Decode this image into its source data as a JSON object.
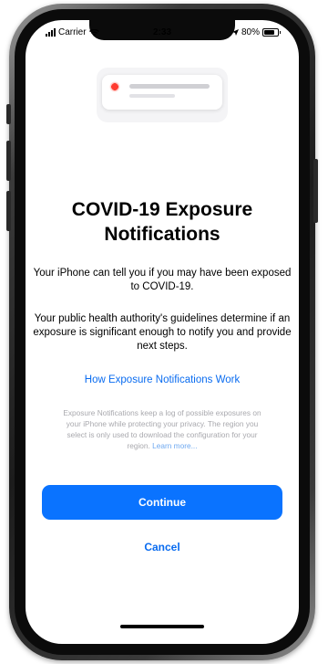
{
  "status_bar": {
    "carrier": "Carrier",
    "time": "2:33",
    "battery_text": "80%",
    "battery_level": 0.8
  },
  "icons": {
    "signal": "signal-bars-icon",
    "wifi": "wifi-icon",
    "location": "location-arrow-icon",
    "battery": "battery-icon",
    "illustration": "exposure-notification-illustration"
  },
  "content": {
    "title": "COVID-19 Exposure Notifications",
    "paragraph1": "Your iPhone can tell you if you may have been exposed to COVID-19.",
    "paragraph2": "Your public health authority's guidelines determine if an exposure is significant enough to notify you and provide next steps.",
    "link": "How Exposure Notifications Work",
    "fine_print": "Exposure Notifications keep a log of possible exposures on your iPhone while protecting your privacy. The region you select is only used to download the configuration for your region.",
    "fine_print_more": "Learn more..."
  },
  "buttons": {
    "continue": "Continue",
    "cancel": "Cancel"
  },
  "colors": {
    "accent": "#0a73ff",
    "virus": "#ff3b30"
  }
}
